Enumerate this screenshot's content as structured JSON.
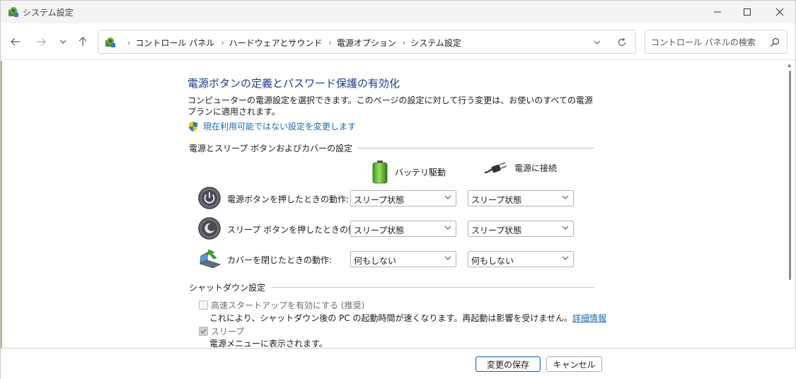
{
  "window": {
    "title": "システム設定"
  },
  "nav": {
    "breadcrumbs": [
      "コントロール パネル",
      "ハードウェアとサウンド",
      "電源オプション",
      "システム設定"
    ],
    "search_placeholder": "コントロール パネルの検索"
  },
  "main": {
    "title": "電源ボタンの定義とパスワード保護の有効化",
    "description": "コンピューターの電源設定を選択できます。このページの設定に対して行う変更は、お使いのすべての電源プランに適用されます。",
    "change_link": "現在利用可能ではない設定を変更します",
    "section_buttons": "電源とスリープ ボタンおよびカバーの設定",
    "col_battery": "バッテリ駆動",
    "col_plugged": "電源に接続",
    "rows": [
      {
        "label": "電源ボタンを押したときの動作:",
        "battery": "スリープ状態",
        "plugged": "スリープ状態"
      },
      {
        "label": "スリープ ボタンを押したときの動作:",
        "battery": "スリープ状態",
        "plugged": "スリープ状態"
      },
      {
        "label": "カバーを閉じたときの動作:",
        "battery": "何もしない",
        "plugged": "何もしない"
      }
    ],
    "section_shutdown": "シャットダウン設定",
    "fast_startup": {
      "label": "高速スタートアップを有効にする (推奨)",
      "desc": "これにより、シャットダウン後の PC の起動時間が速くなります。再起動は影響を受けません。",
      "link": "詳細情報",
      "checked": false
    },
    "sleep": {
      "label": "スリープ",
      "desc": "電源メニューに表示されます。",
      "checked": true
    }
  },
  "footer": {
    "save": "変更の保存",
    "cancel": "キャンセル"
  },
  "colors": {
    "title_blue": "#1a3e8c",
    "link_blue": "#1e6ab0",
    "accent_green": "#9ac36c"
  }
}
